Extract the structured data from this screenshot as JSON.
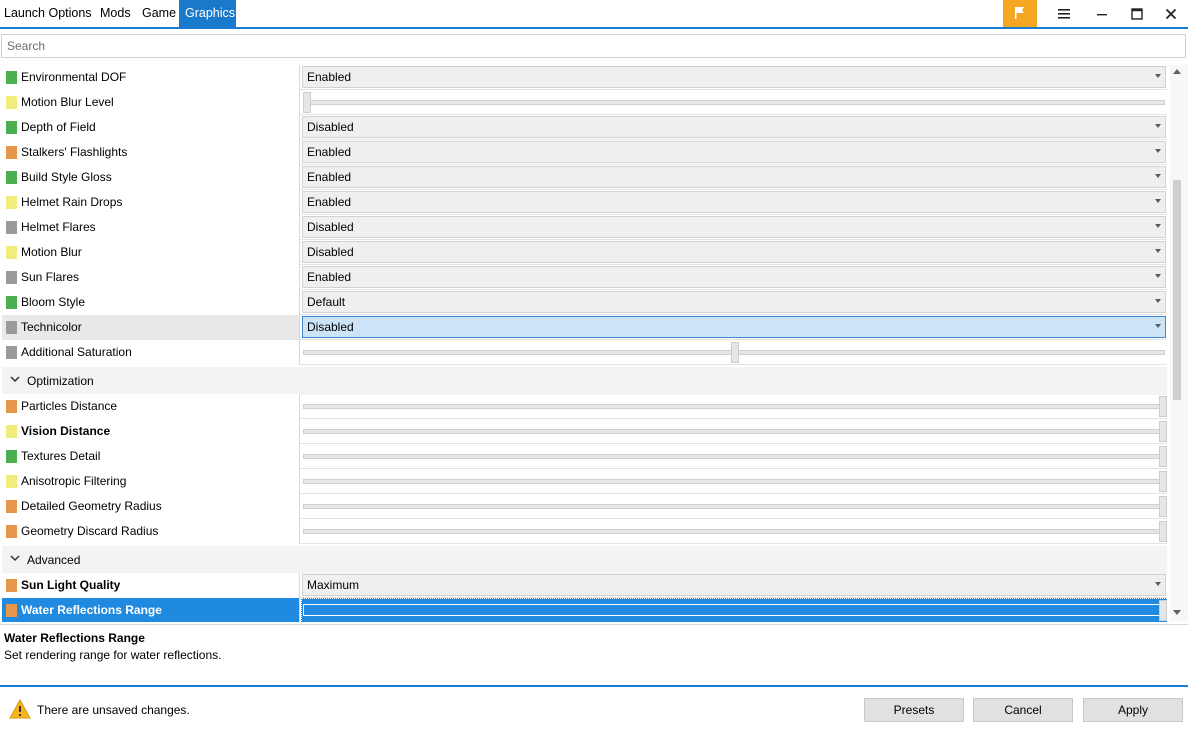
{
  "tabs": [
    {
      "label": "Launch Options",
      "active": false
    },
    {
      "label": "Mods",
      "active": false
    },
    {
      "label": "Game",
      "active": false
    },
    {
      "label": "Graphics",
      "active": true
    }
  ],
  "window": {
    "flag_color": "#f5a623",
    "accent_color": "#1979ca"
  },
  "search": {
    "placeholder": "Search"
  },
  "settings": [
    {
      "label": "Environmental DOF",
      "color": "#4caf50",
      "type": "dropdown",
      "value": "Enabled"
    },
    {
      "label": "Motion Blur Level",
      "color": "#f0ed7e",
      "type": "slider",
      "level": 0
    },
    {
      "label": "Depth of Field",
      "color": "#4caf50",
      "type": "dropdown",
      "value": "Disabled"
    },
    {
      "label": "Stalkers' Flashlights",
      "color": "#e8974a",
      "type": "dropdown",
      "value": "Enabled"
    },
    {
      "label": "Build Style Gloss",
      "color": "#4caf50",
      "type": "dropdown",
      "value": "Enabled"
    },
    {
      "label": "Helmet Rain Drops",
      "color": "#f0ed7e",
      "type": "dropdown",
      "value": "Enabled"
    },
    {
      "label": "Helmet Flares",
      "color": "#9a9a9a",
      "type": "dropdown",
      "value": "Disabled"
    },
    {
      "label": "Motion Blur",
      "color": "#f0ed7e",
      "type": "dropdown",
      "value": "Disabled"
    },
    {
      "label": "Sun Flares",
      "color": "#9a9a9a",
      "type": "dropdown",
      "value": "Enabled"
    },
    {
      "label": "Bloom Style",
      "color": "#4caf50",
      "type": "dropdown",
      "value": "Default"
    },
    {
      "label": "Technicolor",
      "color": "#9a9a9a",
      "type": "dropdown",
      "value": "Disabled",
      "focused": true
    },
    {
      "label": "Additional Saturation",
      "color": "#9a9a9a",
      "type": "slider",
      "level": 0.5
    }
  ],
  "groups": {
    "optimization": {
      "title": "Optimization",
      "items": [
        {
          "label": "Particles Distance",
          "color": "#e8974a",
          "bold": false,
          "level": 1
        },
        {
          "label": "Vision Distance",
          "color": "#f0ed7e",
          "bold": true,
          "level": 1
        },
        {
          "label": "Textures Detail",
          "color": "#4caf50",
          "bold": false,
          "level": 1
        },
        {
          "label": "Anisotropic Filtering",
          "color": "#f0ed7e",
          "bold": false,
          "level": 1
        },
        {
          "label": "Detailed Geometry Radius",
          "color": "#e8974a",
          "bold": false,
          "level": 1
        },
        {
          "label": "Geometry Discard Radius",
          "color": "#e8974a",
          "bold": false,
          "level": 1
        }
      ]
    },
    "advanced": {
      "title": "Advanced",
      "items": [
        {
          "label": "Sun Light Quality",
          "color": "#e8974a",
          "bold": true,
          "type": "dropdown",
          "value": "Maximum"
        },
        {
          "label": "Water Reflections Range",
          "color": "#e8974a",
          "bold": true,
          "type": "slider",
          "level": 1,
          "selected": true
        }
      ]
    }
  },
  "description": {
    "title": "Water Reflections Range",
    "text": "Set rendering range for water reflections."
  },
  "footer": {
    "status": "There are unsaved changes.",
    "presets": "Presets",
    "cancel": "Cancel",
    "apply": "Apply"
  }
}
